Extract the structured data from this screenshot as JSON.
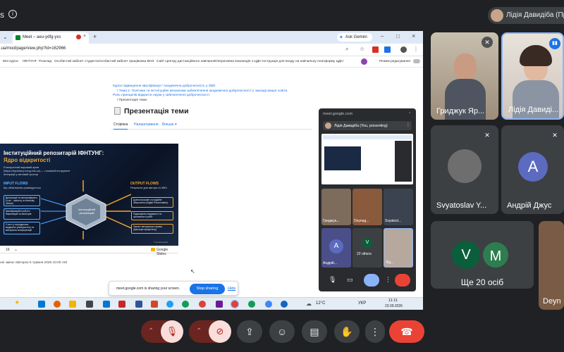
{
  "top": {
    "s_char": "s",
    "presenter_label": "Лідія Давидіба (Пр"
  },
  "browser": {
    "tab_title": "Meet – aeu-ydfg-yxs",
    "new_tab": "+",
    "ask_gemini": "Ask Gemini",
    "url": ".ua/mod/page/view.php?id=162966",
    "bookmarks": [
      "Мої курси",
      "ІФНТУНГ",
      "Розклад",
      "Особистий кабінет студента",
      "Особистий кабінет працівника ВНЗ",
      "Сайт Центру дистанційного навчання",
      "Оперативна взаємодія з ЦДН",
      "Інструкція для входу на навчальну платформу ЦДН"
    ],
    "edit_mode": "Режим редагування"
  },
  "page": {
    "breadcrumbs": [
      "Курси підвищення кваліфікації",
      "/ Академічна доброчесність у ЗВО",
      "/ Тема 2. Політики та інституційні механізми забезпечення академічної доброчесності у закладі вищої освіти.",
      "Роль принципів відкритої науки у забезпеченні доброчесності.",
      "/ Презентація теми"
    ],
    "title": "Презентація теми",
    "tabs": [
      "Сторінка",
      "Налаштування",
      "Більше ▾"
    ],
    "slide_page": "16",
    "google_slides": "Google Slides",
    "last_modified": "нні зміни: вівторок 5 травня 2026 10:00 AM"
  },
  "slide": {
    "title_line1": "Інституційний репозитарій ІФНТУНГ:",
    "title_line2": "Ядро відкритості",
    "subtitle": "Електронний науковий архів (https://repository.nung.edu.ua) — головний інструмент інтеграції у світовий простір",
    "input_flows": "INPUT FLOWS",
    "input_sub": "Що обов'язково розміщується",
    "inputs": [
      "Дисертації та автореферати (з пе... захисту, в повному обсязі)",
      "Кваліфікаційні роботи бакалаврів та магістрів",
      "Статті у періодичних виданнях університету та матеріали конференцій"
    ],
    "center_label": "Інституційний репозитарій",
    "output_flows": "OUTPUT FLOWS",
    "output_sub": "Результат для автора та ЗВО:",
    "outputs": [
      "Довгострокове та надійне зберігання (Digital Preservation)",
      "Підвищення видимості та цитованості робіт",
      "Захист авторського права (фіксація пріоритету)"
    ],
    "credit": "© NotebookLM"
  },
  "sharing": {
    "text": "meet.google.com is sharing your screen.",
    "stop": "Stop sharing",
    "hide": "Hide"
  },
  "taskbar": {
    "temperature": "12°C",
    "lang": "УКР",
    "time": "11:11",
    "date": "23.09.2026"
  },
  "mini_meet": {
    "url": "meet.google.com",
    "presenting": "Лідія Давидіба (You, presenting)",
    "tiles": [
      "Гриджук...",
      "Deynag...",
      "Svyatosl..."
    ],
    "andrii": "Андрій...",
    "initial_a": "A",
    "others_count": "22 others",
    "initial_v": "V",
    "lida": "Лід..."
  },
  "participants": [
    {
      "name": "Гриджук Яр..."
    },
    {
      "name": "Лідія Давиді..."
    },
    {
      "name": "Svyatoslav Y..."
    },
    {
      "name": "Андрій Джус",
      "initial": "A"
    },
    {
      "name": "Ще 20 осіб",
      "initials": [
        "V",
        "M"
      ]
    },
    {
      "name": "Deyn"
    }
  ],
  "colors": {
    "accent": "#1a73e8",
    "end_call": "#ea4335",
    "v_avatar": "#0b5e3c",
    "m_avatar": "#2e7d4f",
    "a_avatar": "#5c6bc0"
  }
}
